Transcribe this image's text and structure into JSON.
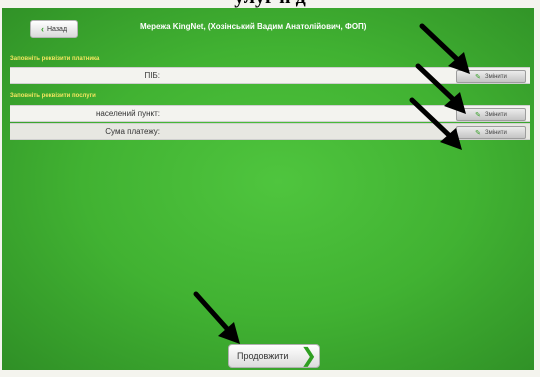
{
  "heading": "улуг п д",
  "header": {
    "back_label": "Назад",
    "back_icon": "chevron-left-icon",
    "title": "Мережа KingNet, (Хозінський Вадим Анатолійович, ФОП)"
  },
  "payer_section": {
    "label": "Заповніть реквізити платника",
    "rows": [
      {
        "label": "ПІБ:",
        "button": "Змінити",
        "icon": "pencil-check-icon"
      }
    ]
  },
  "service_section": {
    "label": "Заповніть реквізити послуги",
    "rows": [
      {
        "label": "населений пункт:",
        "button": "Змінити",
        "icon": "pencil-check-icon"
      },
      {
        "label": "Сума платежу:",
        "button": "Змінити",
        "icon": "pencil-check-icon"
      }
    ]
  },
  "footer": {
    "continue_label": "Продовжити",
    "continue_icon": "chevron-right-icon"
  },
  "colors": {
    "screen_green": "#41b232",
    "section_label": "#f3e65f",
    "accent_green": "#2f9f22"
  }
}
